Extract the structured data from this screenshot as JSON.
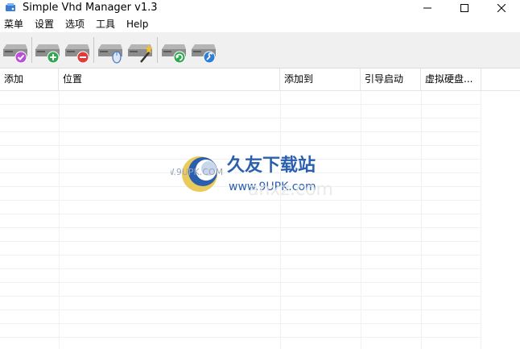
{
  "window": {
    "title": "Simple Vhd Manager v1.3",
    "controls": [
      "minimize",
      "maximize",
      "close"
    ]
  },
  "menu": {
    "items": [
      "菜单",
      "设置",
      "选项",
      "工具",
      "Help"
    ]
  },
  "toolbar": {
    "buttons": [
      {
        "name": "vhd-check",
        "badge": "check",
        "color": "#b84fd6"
      },
      {
        "name": "vhd-add",
        "badge": "plus",
        "color": "#2fa84f"
      },
      {
        "name": "vhd-remove",
        "badge": "minus",
        "color": "#e03a3a"
      },
      {
        "name": "vhd-mouse",
        "badge": "mouse",
        "color": "#4a78c8"
      },
      {
        "name": "vhd-wizard",
        "badge": "wand",
        "color": "#e8a020"
      },
      {
        "name": "vhd-refresh",
        "badge": "refresh",
        "color": "#2fa84f"
      },
      {
        "name": "vhd-settings",
        "badge": "wrench",
        "color": "#2f7fd6"
      }
    ]
  },
  "table": {
    "columns": [
      "添加",
      "位置",
      "添加到",
      "引导启动",
      "虚拟硬盘..."
    ],
    "rows": []
  },
  "watermark": {
    "text_main": "久友下载站",
    "text_url": "WWW.9UPK.COM",
    "text_url2": "www.9UPK.com",
    "text_bg": "anxz.com"
  }
}
